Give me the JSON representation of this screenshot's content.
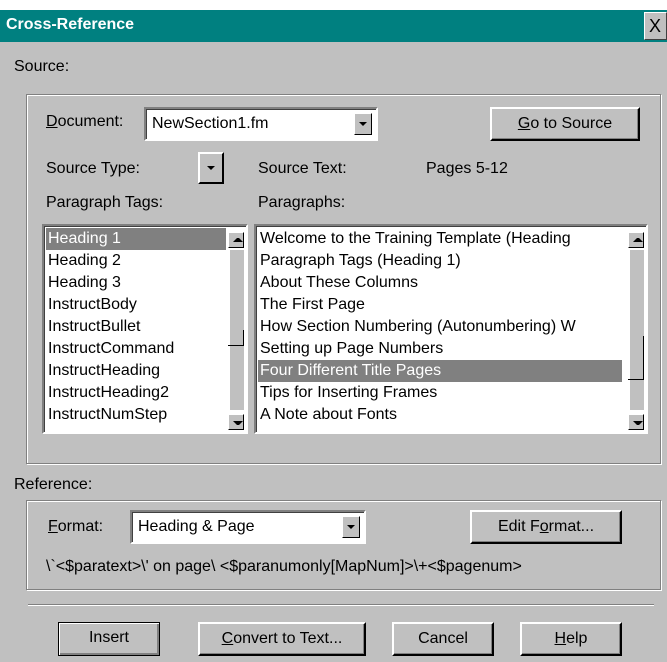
{
  "window": {
    "title": "Cross-Reference",
    "close_label": "X"
  },
  "source": {
    "group_label": "Source:",
    "document_label_prefix": "D",
    "document_label_rest": "ocument:",
    "document_value": "NewSection1.fm",
    "goto_prefix": "G",
    "goto_rest": "o to Source",
    "source_type_label": "Source Type:",
    "source_text_label": "Source Text:",
    "source_text_value": "Pages  5-12",
    "paragraph_tags_label": "Paragraph Tags:",
    "paragraphs_label": "Paragraphs:",
    "paragraph_tags": [
      "Heading 1",
      "Heading 2",
      "Heading 3",
      "InstructBody",
      "InstructBullet",
      "InstructCommand",
      "InstructHeading",
      "InstructHeading2",
      "InstructNumStep"
    ],
    "paragraphs": [
      "Welcome to the Training Template (Heading",
      "Paragraph Tags (Heading 1)",
      "About These Columns",
      "The First Page",
      "How Section Numbering (Autonumbering) W",
      "Setting up Page Numbers",
      "Four Different Title Pages",
      "Tips for Inserting Frames",
      "A Note about Fonts"
    ]
  },
  "reference": {
    "group_label": "Reference:",
    "format_prefix": "F",
    "format_rest": "ormat:",
    "format_value": "Heading & Page",
    "edit_format_pre": "Edit F",
    "edit_format_ul": "o",
    "edit_format_post": "rmat...",
    "format_string": "\\`<$paratext>\\' on page\\ <$paranumonly[MapNum]>\\+<$pagenum>"
  },
  "buttons": {
    "insert": "Insert",
    "convert_prefix": "C",
    "convert_rest": "onvert to Text...",
    "cancel": "Cancel",
    "help_prefix": "H",
    "help_rest": "elp"
  }
}
